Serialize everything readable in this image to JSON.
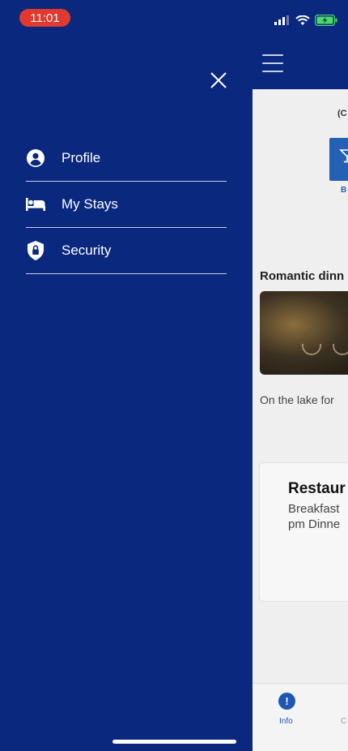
{
  "status_bar": {
    "time": "11:01"
  },
  "drawer": {
    "close_icon": "close-icon",
    "items": [
      {
        "label": "Profile",
        "icon": "user-circle-icon"
      },
      {
        "label": "My Stays",
        "icon": "bed-icon"
      },
      {
        "label": "Security",
        "icon": "shield-lock-icon"
      }
    ]
  },
  "background": {
    "subtitle": "(C",
    "tile_label": "B",
    "card_title": "Romantic dinn",
    "description": "On the lake for",
    "restaurant": {
      "title": "Restaur",
      "line1": "Breakfast",
      "line2": "pm  Dinne"
    },
    "tabs": [
      {
        "label": "Info"
      },
      {
        "label": "C"
      }
    ]
  },
  "colors": {
    "drawer_bg": "#0b287f",
    "time_pill": "#e0392f",
    "accent": "#1f56b3"
  }
}
